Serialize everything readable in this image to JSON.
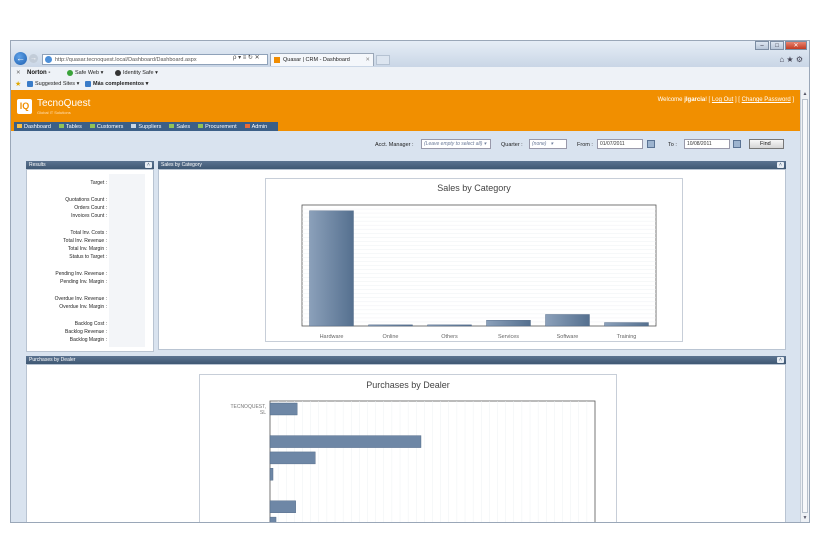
{
  "browser": {
    "url": "http://quasar.tecnoquest.local/Dashboard/Dashboard.aspx",
    "address_tools": "ρ ▾ ≡ ↻ ✕",
    "tab_title": "Quasar | CRM - Dashboard",
    "tab_close": "✕",
    "window_buttons": [
      "–",
      "□",
      "✕"
    ],
    "right_icons": "⌂ ★ ⚙",
    "toolbar1": {
      "close": "✕",
      "norton": "Norton -",
      "safe_web": "Safe Web ▾",
      "identity_safe": "Identity Safe ▾"
    },
    "toolbar2": {
      "suggested_sites": "Suggested Sites ▾",
      "mas_complementos": "Más complementos ▾"
    }
  },
  "app": {
    "logo_mark": "IQ",
    "logo_name": "TecnoQuest",
    "logo_tagline": "Global IT Solutions",
    "welcome_prefix": "Welcome ",
    "username": "jlgarcia",
    "welcome_suffix": "! [",
    "logout": "Log Out",
    "sep": "]  [",
    "change_password": "Change Password",
    "end_bracket": "]",
    "menu": [
      "Dashboard",
      "Tables",
      "Customers",
      "Suppliers",
      "Sales",
      "Procurement",
      "Admin"
    ]
  },
  "filters": {
    "acct_manager_label": "Acct. Manager :",
    "acct_manager_value": "(Leave empty to select all)",
    "quarter_label": "Quarter :",
    "quarter_value": "(none)",
    "from_label": "From :",
    "from_value": "01/07/2011",
    "to_label": "To :",
    "to_value": "10/08/2011",
    "find_label": "Find"
  },
  "results": {
    "title": "Results",
    "collapse": "˄",
    "rows": [
      "Target :",
      "Quotations Count :",
      "Orders Count :",
      "Invoices Count :",
      "Total Inv. Costs :",
      "Total Inv. Revenue :",
      "Total Inv. Margin :",
      "Status to Target :",
      "Pending Inv. Revenue :",
      "Pending Inv. Margin :",
      "Overdue Inv. Revenue :",
      "Overdue Inv. Margin :",
      "Backlog Cost :",
      "Backlog Revenue :",
      "Backlog Margin :"
    ]
  },
  "sales_panel": {
    "title": "Sales by Category",
    "collapse": "˄"
  },
  "dealer_panel": {
    "title": "Purchases by Dealer",
    "collapse": "˄"
  },
  "chart_data": [
    {
      "type": "bar",
      "title": "Sales by Category",
      "categories": [
        "Hardware",
        "Online",
        "Others",
        "Services",
        "Software",
        "Training"
      ],
      "values": [
        100,
        1,
        1,
        5,
        10,
        3
      ],
      "ylim": [
        0,
        105
      ],
      "grid": true
    },
    {
      "type": "bar",
      "orientation": "horizontal",
      "title": "Purchases by Dealer",
      "categories": [
        "TECNOQUEST, SL",
        "",
        "",
        "",
        "",
        "",
        "",
        ""
      ],
      "values": [
        18,
        0,
        100,
        30,
        2,
        0,
        17,
        4
      ],
      "grid": true
    }
  ]
}
